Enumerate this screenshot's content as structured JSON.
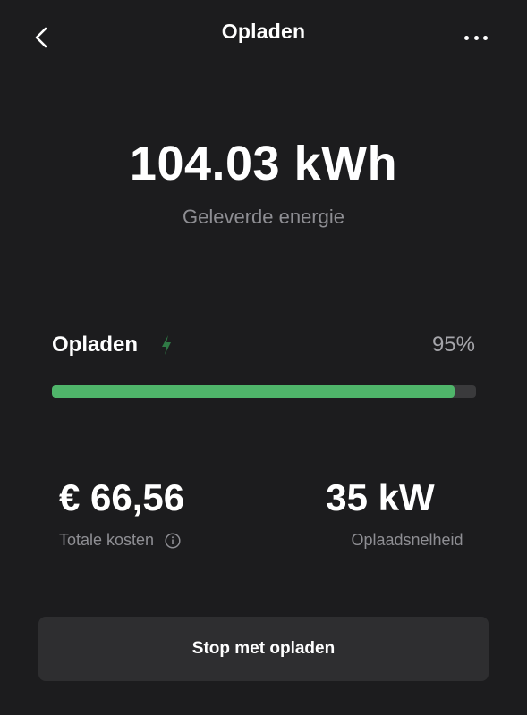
{
  "header": {
    "title": "Opladen",
    "back_icon": "chevron-left-icon",
    "more_icon": "more-horizontal-icon"
  },
  "energy": {
    "value": "104.03 kWh",
    "label": "Geleverde energie"
  },
  "charging": {
    "label": "Opladen",
    "icon": "lightning-bolt-icon",
    "percent_text": "95%",
    "progress": 0.95,
    "accent_color": "#4fb56a"
  },
  "stats": {
    "cost_value": "€ 66,56",
    "cost_label": "Totale kosten",
    "speed_value": "35 kW",
    "speed_label": "Oplaadsnelheid"
  },
  "actions": {
    "stop_label": "Stop met opladen"
  }
}
